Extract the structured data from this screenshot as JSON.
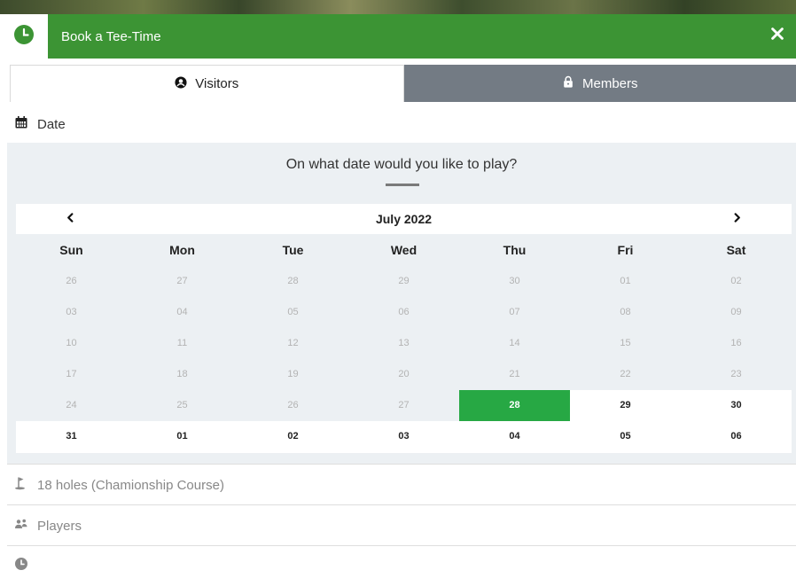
{
  "header": {
    "title": "Book a Tee-Time",
    "brand_color": "#3c9434",
    "icon": "clock-icon",
    "close_icon": "close-icon"
  },
  "tabs": [
    {
      "label": "Visitors",
      "icon": "user-circle-icon",
      "active": true
    },
    {
      "label": "Members",
      "icon": "lock-icon",
      "active": false
    }
  ],
  "date_section": {
    "label": "Date",
    "icon": "calendar-icon",
    "question": "On what date would you like to play?"
  },
  "calendar": {
    "month_label": "July 2022",
    "prev_icon": "chevron-left-icon",
    "next_icon": "chevron-right-icon",
    "weekdays": [
      "Sun",
      "Mon",
      "Tue",
      "Wed",
      "Thu",
      "Fri",
      "Sat"
    ],
    "weeks": [
      [
        "26",
        "27",
        "28",
        "29",
        "30",
        "01",
        "02"
      ],
      [
        "03",
        "04",
        "05",
        "06",
        "07",
        "08",
        "09"
      ],
      [
        "10",
        "11",
        "12",
        "13",
        "14",
        "15",
        "16"
      ],
      [
        "17",
        "18",
        "19",
        "20",
        "21",
        "22",
        "23"
      ],
      [
        "24",
        "25",
        "26",
        "27",
        "28",
        "29",
        "30"
      ],
      [
        "31",
        "01",
        "02",
        "03",
        "04",
        "05",
        "06"
      ]
    ],
    "selected_date": "28",
    "selected_color": "#27a844"
  },
  "course_section": {
    "label": "18 holes (Chamionship Course)",
    "icon": "golf-flag-icon"
  },
  "players_section": {
    "label": "Players",
    "icon": "users-icon"
  },
  "time_section": {
    "label": "",
    "icon": "clock-icon"
  }
}
